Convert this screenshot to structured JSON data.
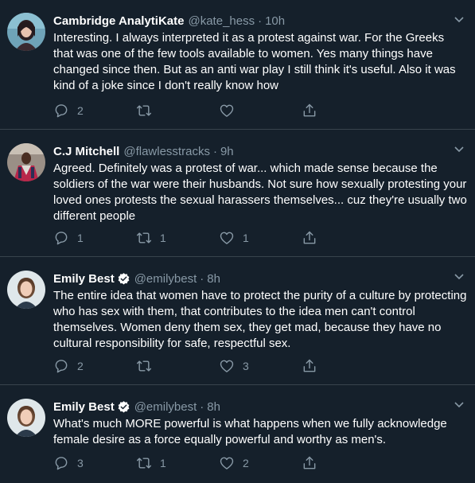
{
  "tweets": [
    {
      "name": "Cambridge AnalytiKate",
      "handle": "@kate_hess",
      "time": "10h",
      "verified": false,
      "text": "Interesting. I always interpreted it as a protest against war. For the Greeks that was one of the few tools available to women. Yes many things have changed since then. But as an anti war play I still think it's useful. Also it was kind of a joke since I don't really know how",
      "replies": "2",
      "retweets": "",
      "likes": ""
    },
    {
      "name": "C.J Mitchell",
      "handle": "@flawlesstracks",
      "time": "9h",
      "verified": false,
      "text": "Agreed. Definitely was a protest of war... which made sense because the soldiers of the war were their husbands. Not sure how sexually protesting your loved ones protests the sexual harassers themselves... cuz they're usually two different people",
      "replies": "1",
      "retweets": "1",
      "likes": "1"
    },
    {
      "name": "Emily Best",
      "handle": "@emilybest",
      "time": "8h",
      "verified": true,
      "text": "The entire idea that women have to protect the purity of a culture by protecting who has sex with them, that contributes to the idea men can't control themselves. Women deny them sex, they get mad, because they have no cultural responsibility for safe, respectful sex.",
      "replies": "2",
      "retweets": "",
      "likes": "3"
    },
    {
      "name": "Emily Best",
      "handle": "@emilybest",
      "time": "8h",
      "verified": true,
      "text": "What's much MORE powerful is what happens when we fully acknowledge female desire as a force equally powerful and worthy as men's.",
      "replies": "3",
      "retweets": "1",
      "likes": "2"
    }
  ],
  "separator": "·",
  "colors": {
    "background": "#15202b",
    "divider": "#38444d",
    "muted": "#8899a6",
    "verified": "#ffffff"
  }
}
